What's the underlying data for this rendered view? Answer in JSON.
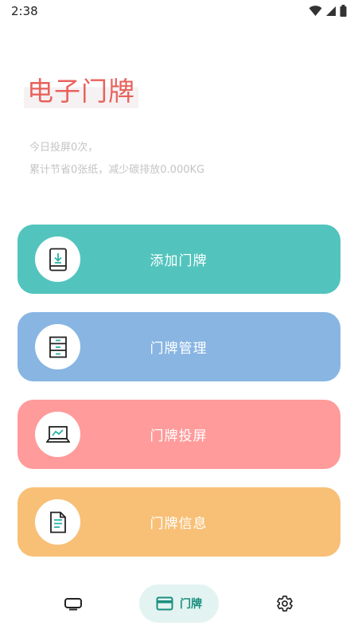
{
  "status_bar": {
    "time": "2:38",
    "icons": [
      "wifi-icon",
      "signal-icon",
      "battery-icon"
    ]
  },
  "header": {
    "title": "电子门牌",
    "stats_line1": "今日投屏0次，",
    "stats_line2": "累计节省0张纸，减少碳排放0.000KG"
  },
  "menu": {
    "items": [
      {
        "label": "添加门牌",
        "icon": "tablet-download-icon",
        "color": "#52c4bd"
      },
      {
        "label": "门牌管理",
        "icon": "cabinet-icon",
        "color": "#88b5e2"
      },
      {
        "label": "门牌投屏",
        "icon": "laptop-chart-icon",
        "color": "#ff9b9b"
      },
      {
        "label": "门牌信息",
        "icon": "document-icon",
        "color": "#f8c077"
      }
    ]
  },
  "bottom_nav": {
    "items": [
      {
        "icon": "tv-icon",
        "label": "",
        "active": false
      },
      {
        "icon": "card-icon",
        "label": "门牌",
        "active": true
      },
      {
        "icon": "gear-icon",
        "label": "",
        "active": false
      }
    ],
    "active_color": "#1a8f7f",
    "active_bg": "#e3f3f1"
  }
}
